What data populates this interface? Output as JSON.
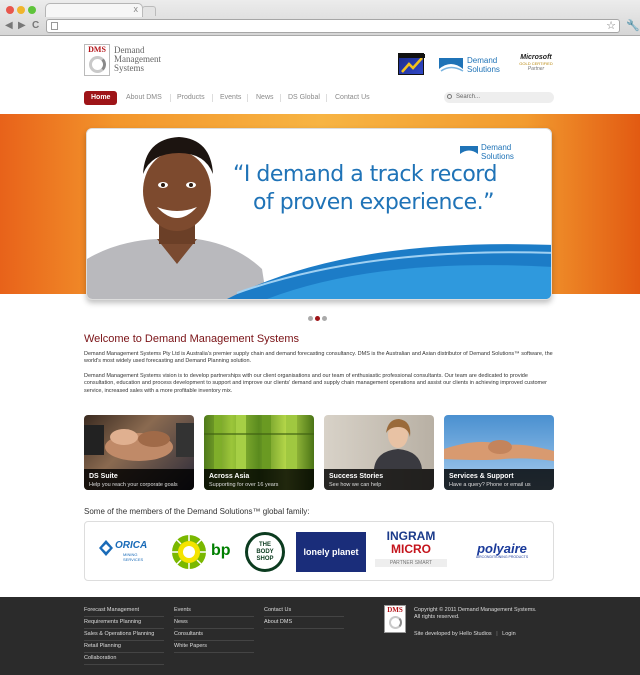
{
  "browser": {
    "back": "◀",
    "forward": "▶",
    "reload": "C",
    "star": "☆",
    "wrench": "🔧",
    "tab_close": "x"
  },
  "logo": {
    "mark_text": "DMS",
    "name_line1": "Demand",
    "name_line2": "Management",
    "name_line3": "Systems"
  },
  "partners": {
    "ds_name": "Demand",
    "ds_name2": "Solutions",
    "ms_line1": "Microsoft",
    "ms_line2": "GOLD CERTIFIED",
    "ms_line3": "Partner"
  },
  "nav": {
    "items": [
      "Home",
      "About DMS",
      "Products",
      "Events",
      "News",
      "DS Global",
      "Contact Us"
    ]
  },
  "search": {
    "placeholder": "Search..."
  },
  "slide": {
    "quote_line1": "“I demand a track record",
    "quote_line2": "of proven experience.”",
    "logo_line1": "Demand",
    "logo_line2": "Solutions"
  },
  "welcome": {
    "title": "Welcome to Demand Management Systems",
    "para1": "Demand Management Systems Pty Ltd is Australia's premier supply chain and demand forecasting consultancy. DMS is the Australian and Asian distributor of Demand Solutions™ software, the world's most widely used forecasting and Demand Planning solution.",
    "para2": "Demand Management Systems vision is to develop partnerships with our client organisations and our team of enthusiastic professional consultants. Our team are dedicated to provide consultation, education and process development to support and improve our clients' demand and supply chain management operations and assist our clients in achieving improved customer service, increased sales with a more profitable inventory mix."
  },
  "tiles": [
    {
      "title": "DS Suite",
      "subtitle": "Help you reach your corporate goals"
    },
    {
      "title": "Across Asia",
      "subtitle": "Supporting for over 16 years"
    },
    {
      "title": "Success Stories",
      "subtitle": "See how we can help"
    },
    {
      "title": "Services & Support",
      "subtitle": "Have a query? Phone or email us"
    }
  ],
  "members": {
    "heading": "Some of the members of the Demand Solutions™ global family:",
    "orica1": "ORICA",
    "orica2": "MINING",
    "orica3": "SERVICES",
    "bp": "bp",
    "bodyshop1": "THE",
    "bodyshop2": "BODY",
    "bodyshop3": "SHOP",
    "lonely": "lonely planet",
    "ingram1": "INGRAM",
    "ingram2": "MICRO",
    "ingram3": "PARTNER SMART",
    "polyaire1": "polyaire",
    "polyaire2": "AIRCONDITIONING PRODUCTS"
  },
  "footer": {
    "col1": [
      "Forecast Management",
      "Requirements Planning",
      "Sales & Operations Planning",
      "Retail Planning",
      "Collaboration"
    ],
    "col2": [
      "Events",
      "News",
      "Consultants",
      "White Papers"
    ],
    "col3": [
      "Contact Us",
      "About DMS"
    ],
    "copyright1": "Copyright © 2011 Demand Management Systems.",
    "copyright2": "All rights reserved.",
    "dev": "Site developed by Hello Studios",
    "login": "Login"
  }
}
